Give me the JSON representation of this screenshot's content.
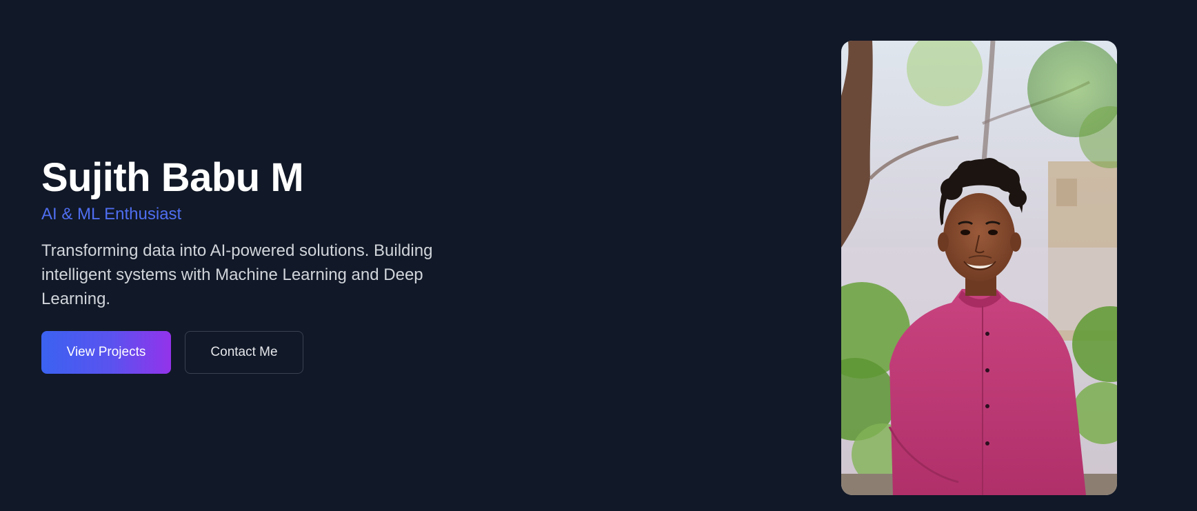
{
  "hero": {
    "name": "Sujith Babu M",
    "role": "AI & ML Enthusiast",
    "tagline": "Transforming data into AI-powered solutions. Building intelligent systems with Machine Learning and Deep Learning.",
    "primary_button": "View Projects",
    "secondary_button": "Contact Me"
  },
  "photo": {
    "subject": "portrait of a smiling young man in a pink shirt outdoors"
  },
  "colors": {
    "background": "#111827",
    "accent": "#4f6ef0",
    "gradient_start": "#3b62f1",
    "gradient_end": "#9333ea",
    "shirt": "#c23a78"
  }
}
